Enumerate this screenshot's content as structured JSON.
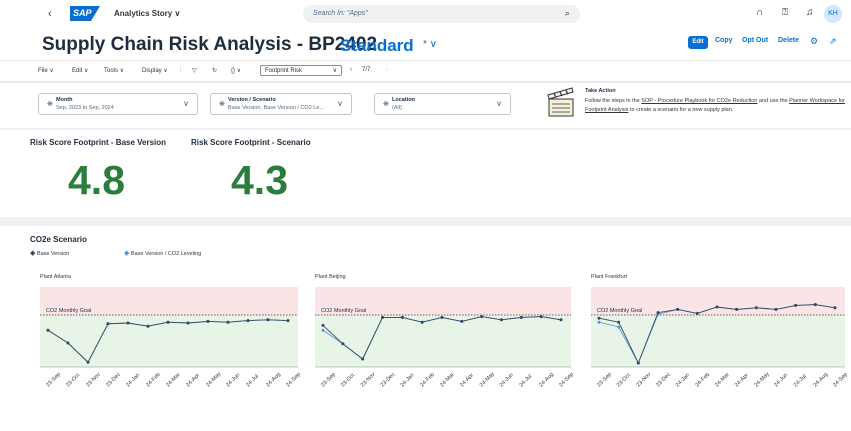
{
  "shell": {
    "back": "‹",
    "logo": "SAP",
    "app_name": "Analytics Story ∨",
    "search_placeholder": "Search In: \"Apps\"",
    "avatar": "KH"
  },
  "header": {
    "title": "Supply Chain Risk Analysis - BP2402",
    "variant": "Standard",
    "variant_mark": "* ∨",
    "actions": {
      "edit": "Edit",
      "copy": "Copy",
      "opt_out": "Opt Out",
      "delete": "Delete"
    }
  },
  "toolbar": {
    "file": "File ∨",
    "edit": "Edit ∨",
    "tools": "Tools ∨",
    "display": "Display ∨",
    "page_select": "Footprint Risk",
    "page_counter": "7/7"
  },
  "filters": [
    {
      "label": "Month",
      "value": "Sep, 2023 to Sep, 2024"
    },
    {
      "label": "Version / Scenario",
      "value": "Base Version, Base Version / CO2 Le..."
    },
    {
      "label": "Location",
      "value": "(All)"
    }
  ],
  "take_action": {
    "title": "Take Action",
    "text_1": "Follow the steps in the ",
    "link_1": "SOP - Procedure Playbook for CO2e Reduction",
    "text_2": " and use the ",
    "link_2": "Planner Workspace for Footprint Analysis",
    "text_3": " to create a scenario for a new supply plan."
  },
  "kpis": [
    {
      "title": "Risk Score Footprint - Base Version",
      "value": "4.8"
    },
    {
      "title": "Risk Score Footprint - Scenario",
      "value": "4.3"
    }
  ],
  "co2": {
    "title": "CO2e Scenario",
    "legend": [
      "Base Version",
      "Base Version / CO2 Leveling"
    ],
    "goal_label": "CO2 Monthly Goal"
  },
  "chart_data": [
    {
      "type": "line",
      "title": "Plant Atlanta",
      "categories": [
        "23-Sep",
        "23-Oct",
        "23-Nov",
        "23-Dec",
        "24-Jan",
        "24-Feb",
        "24-Mar",
        "24-Apr",
        "24-May",
        "24-Jun",
        "24-Jul",
        "24-Aug",
        "24-Sep"
      ],
      "series": [
        {
          "name": "Base Version",
          "values": [
            0.46,
            0.3,
            0.06,
            0.54,
            0.55,
            0.51,
            0.56,
            0.55,
            0.57,
            0.56,
            0.58,
            0.59,
            0.58
          ]
        },
        {
          "name": "Base Version / CO2 Leveling",
          "values": [
            0.46,
            0.3,
            0.06,
            0.54,
            0.55,
            0.51,
            0.56,
            0.55,
            0.57,
            0.56,
            0.58,
            0.59,
            0.58
          ]
        }
      ],
      "goal": 0.65,
      "ylim": [
        0,
        1
      ]
    },
    {
      "type": "line",
      "title": "Plant Beijing",
      "categories": [
        "23-Sep",
        "23-Oct",
        "23-Nov",
        "23-Dec",
        "24-Jan",
        "24-Feb",
        "24-Mar",
        "24-Apr",
        "24-May",
        "24-Jun",
        "24-Jul",
        "24-Aug",
        "24-Sep"
      ],
      "series": [
        {
          "name": "Base Version",
          "values": [
            0.52,
            0.29,
            0.1,
            0.62,
            0.62,
            0.56,
            0.62,
            0.57,
            0.63,
            0.59,
            0.62,
            0.63,
            0.59
          ]
        },
        {
          "name": "Base Version / CO2 Leveling",
          "values": [
            0.46,
            0.29,
            0.1,
            0.62,
            0.62,
            0.56,
            0.62,
            0.57,
            0.63,
            0.59,
            0.62,
            0.63,
            0.59
          ]
        }
      ],
      "goal": 0.65,
      "ylim": [
        0,
        1
      ]
    },
    {
      "type": "line",
      "title": "Plant Frankfurt",
      "categories": [
        "23-Sep",
        "23-Oct",
        "23-Nov",
        "23-Dec",
        "24-Jan",
        "24-Feb",
        "24-Mar",
        "24-Apr",
        "24-May",
        "24-Jun",
        "24-Jul",
        "24-Aug",
        "24-Sep"
      ],
      "series": [
        {
          "name": "Base Version",
          "values": [
            0.61,
            0.56,
            0.05,
            0.68,
            0.72,
            0.67,
            0.75,
            0.72,
            0.74,
            0.72,
            0.77,
            0.78,
            0.74
          ]
        },
        {
          "name": "Base Version / CO2 Leveling",
          "values": [
            0.56,
            0.5,
            0.05,
            0.66,
            0.72,
            0.67,
            0.75,
            0.72,
            0.74,
            0.72,
            0.77,
            0.78,
            0.74
          ]
        }
      ],
      "goal": 0.65,
      "ylim": [
        0,
        1
      ]
    }
  ]
}
